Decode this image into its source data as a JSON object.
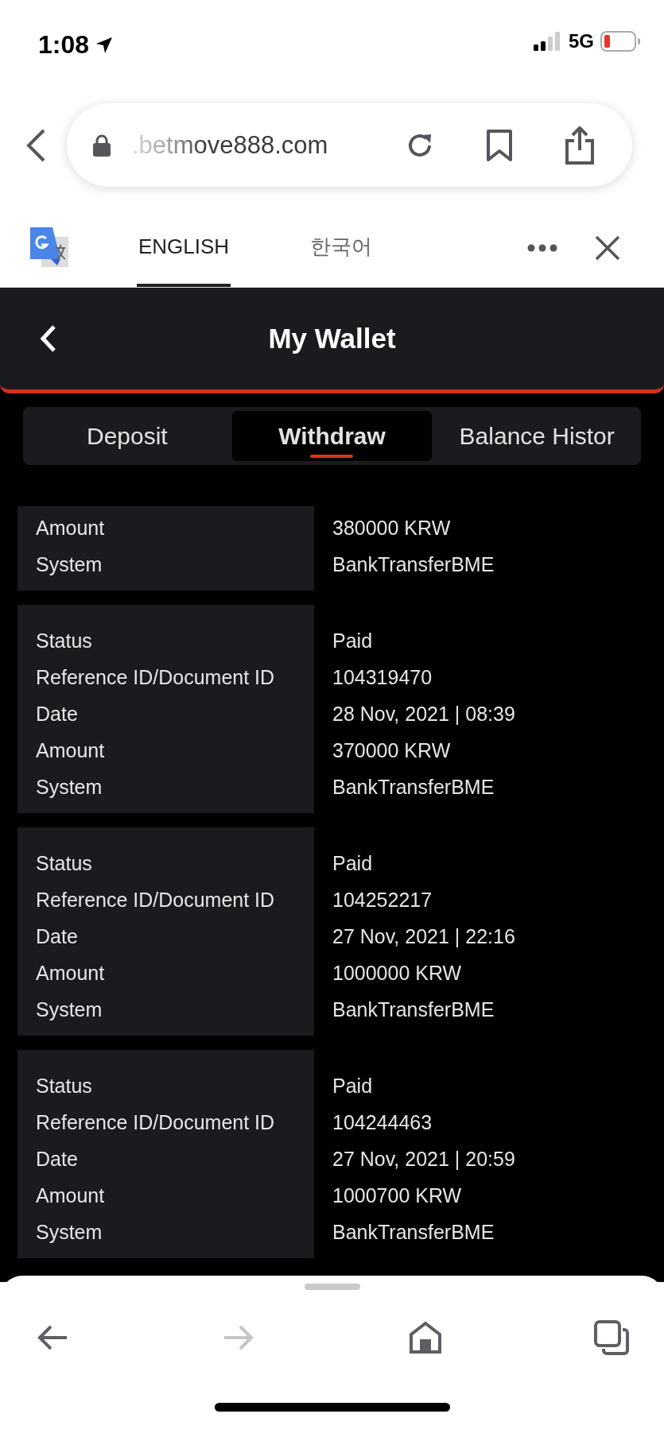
{
  "status_bar": {
    "time": "1:08",
    "network": "5G"
  },
  "address_bar": {
    "url": ".betmove888.com"
  },
  "translate_bar": {
    "languages": [
      {
        "label": "ENGLISH",
        "selected": true
      },
      {
        "label": "한국어",
        "selected": false
      }
    ]
  },
  "header": {
    "title": "My Wallet"
  },
  "tabs": [
    {
      "label": "Deposit",
      "selected": false
    },
    {
      "label": "Withdraw",
      "selected": true
    },
    {
      "label": "Balance Histor",
      "selected": false
    }
  ],
  "records": [
    {
      "rows": [
        {
          "label": "Amount",
          "value": "380000 KRW"
        },
        {
          "label": "System",
          "value": "BankTransferBME"
        }
      ]
    },
    {
      "rows": [
        {
          "label": "Status",
          "value": "Paid"
        },
        {
          "label": "Reference ID/Document ID",
          "value": "104319470"
        },
        {
          "label": "Date",
          "value": "28 Nov, 2021 | 08:39"
        },
        {
          "label": "Amount",
          "value": "370000 KRW"
        },
        {
          "label": "System",
          "value": "BankTransferBME"
        }
      ]
    },
    {
      "rows": [
        {
          "label": "Status",
          "value": "Paid"
        },
        {
          "label": "Reference ID/Document ID",
          "value": "104252217"
        },
        {
          "label": "Date",
          "value": "27 Nov, 2021 | 22:16"
        },
        {
          "label": "Amount",
          "value": "1000000 KRW"
        },
        {
          "label": "System",
          "value": "BankTransferBME"
        }
      ]
    },
    {
      "rows": [
        {
          "label": "Status",
          "value": "Paid"
        },
        {
          "label": "Reference ID/Document ID",
          "value": "104244463"
        },
        {
          "label": "Date",
          "value": "27 Nov, 2021 | 20:59"
        },
        {
          "label": "Amount",
          "value": "1000700 KRW"
        },
        {
          "label": "System",
          "value": "BankTransferBME"
        }
      ]
    }
  ],
  "toolbar": {
    "buttons": [
      {
        "kind": "back",
        "disabled": false
      },
      {
        "kind": "forward",
        "disabled": true
      },
      {
        "kind": "home",
        "disabled": false
      },
      {
        "kind": "tabs",
        "disabled": false
      }
    ]
  }
}
